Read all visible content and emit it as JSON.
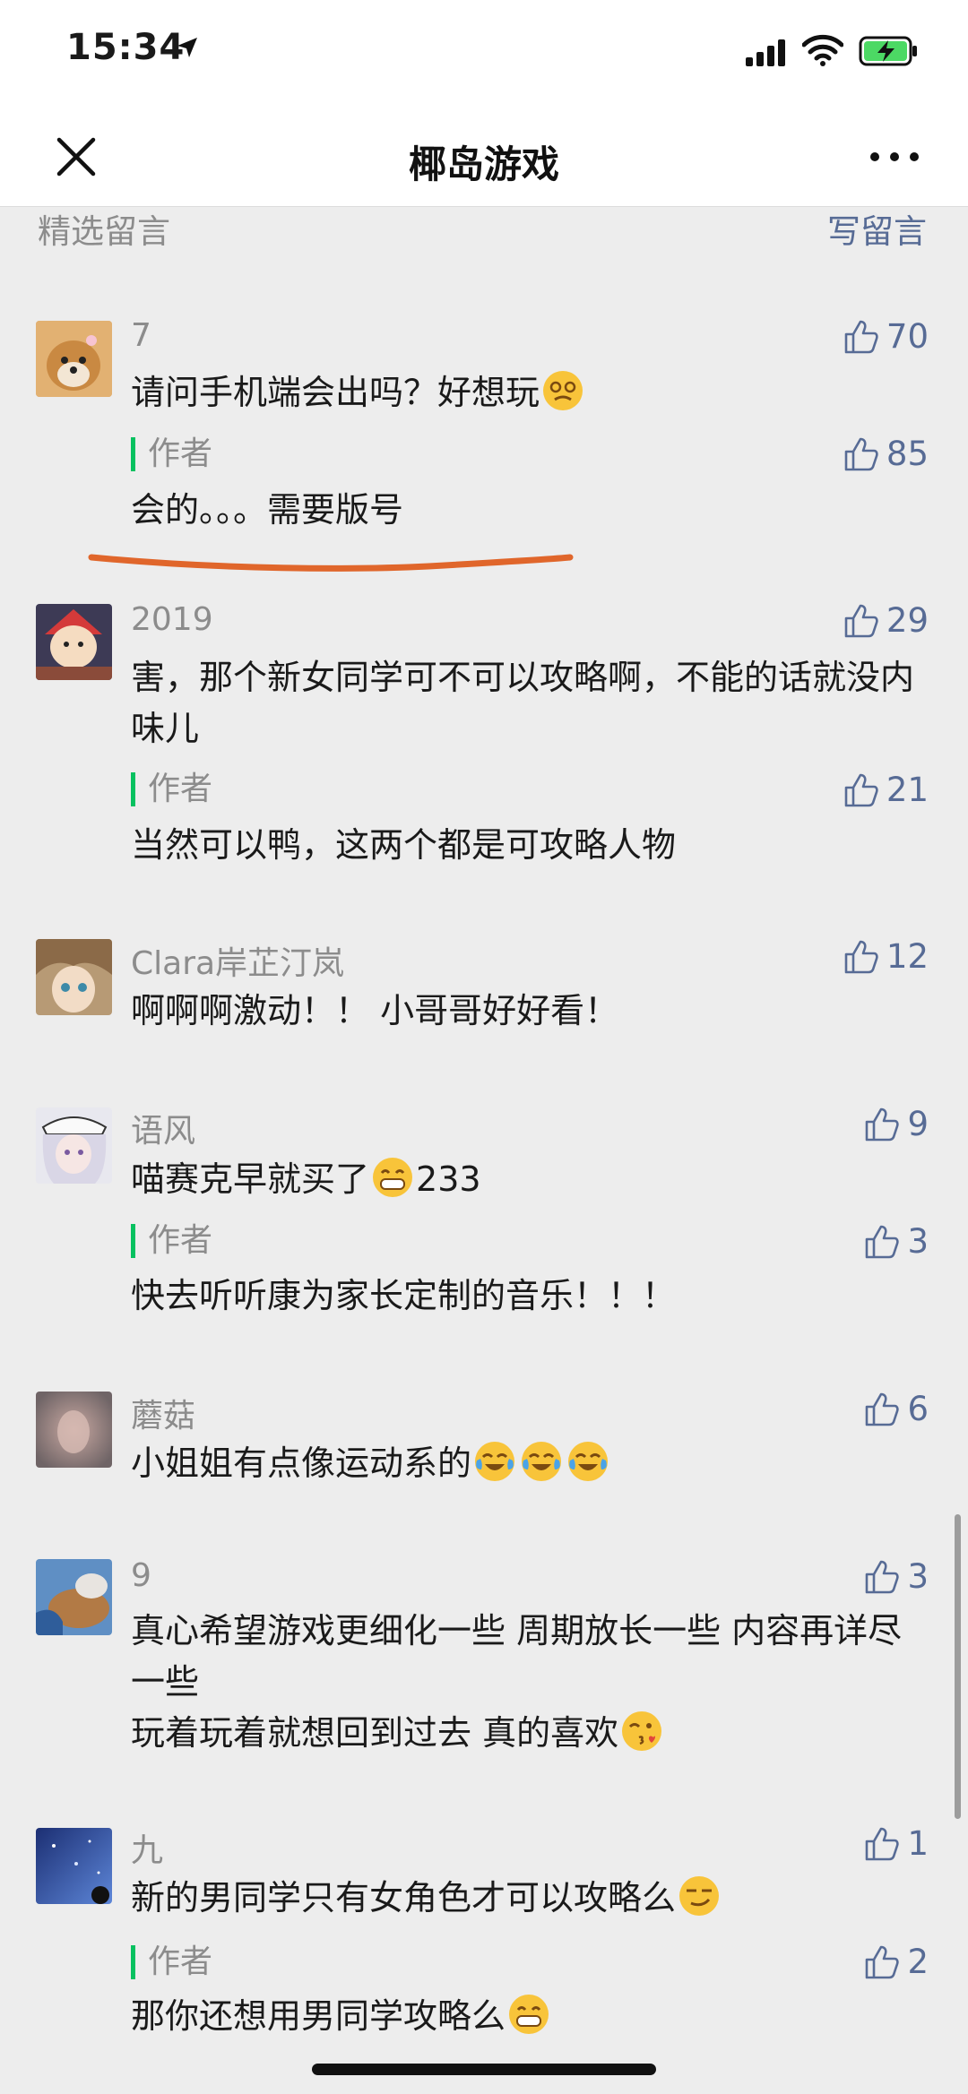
{
  "status": {
    "time": "15:34"
  },
  "nav": {
    "title": "椰岛游戏"
  },
  "section": {
    "title": "精选留言",
    "write": "写留言"
  },
  "comments": [
    {
      "nick": "7",
      "text": "请问手机端会出吗？好想玩",
      "likes": "70",
      "reply": {
        "label": "作者",
        "text": "会的。。。需要版号",
        "likes": "85"
      }
    },
    {
      "nick": "2019",
      "text": "害，那个新女同学可不可以攻略啊，不能的话就没内味儿",
      "likes": "29",
      "reply": {
        "label": "作者",
        "text": "当然可以鸭，这两个都是可攻略人物",
        "likes": "21"
      }
    },
    {
      "nick": "Clara岸芷汀岚",
      "text": "啊啊啊激动！！ 小哥哥好好看！",
      "likes": "12"
    },
    {
      "nick": "语风",
      "text_a": "喵赛克早就买了",
      "text_b": "233",
      "likes": "9",
      "reply": {
        "label": "作者",
        "text": "快去听听康为家长定制的音乐！！！",
        "likes": "3"
      }
    },
    {
      "nick": "蘑菇",
      "text": "小姐姐有点像运动系的",
      "likes": "6"
    },
    {
      "nick": "9",
      "text": "真心希望游戏更细化一些 周期放长一些 内容再详尽一些",
      "text2": "玩着玩着就想回到过去 真的喜欢",
      "likes": "3"
    },
    {
      "nick": "九",
      "text": "新的男同学只有女角色才可以攻略么",
      "likes": "1",
      "reply": {
        "label": "作者",
        "text": "那你还想用男同学攻略么",
        "likes": "2"
      }
    }
  ],
  "colors": {
    "accent": "#576b95",
    "author_bar": "#07c160",
    "annotation": "#e0662b",
    "battery": "#4cd964"
  }
}
